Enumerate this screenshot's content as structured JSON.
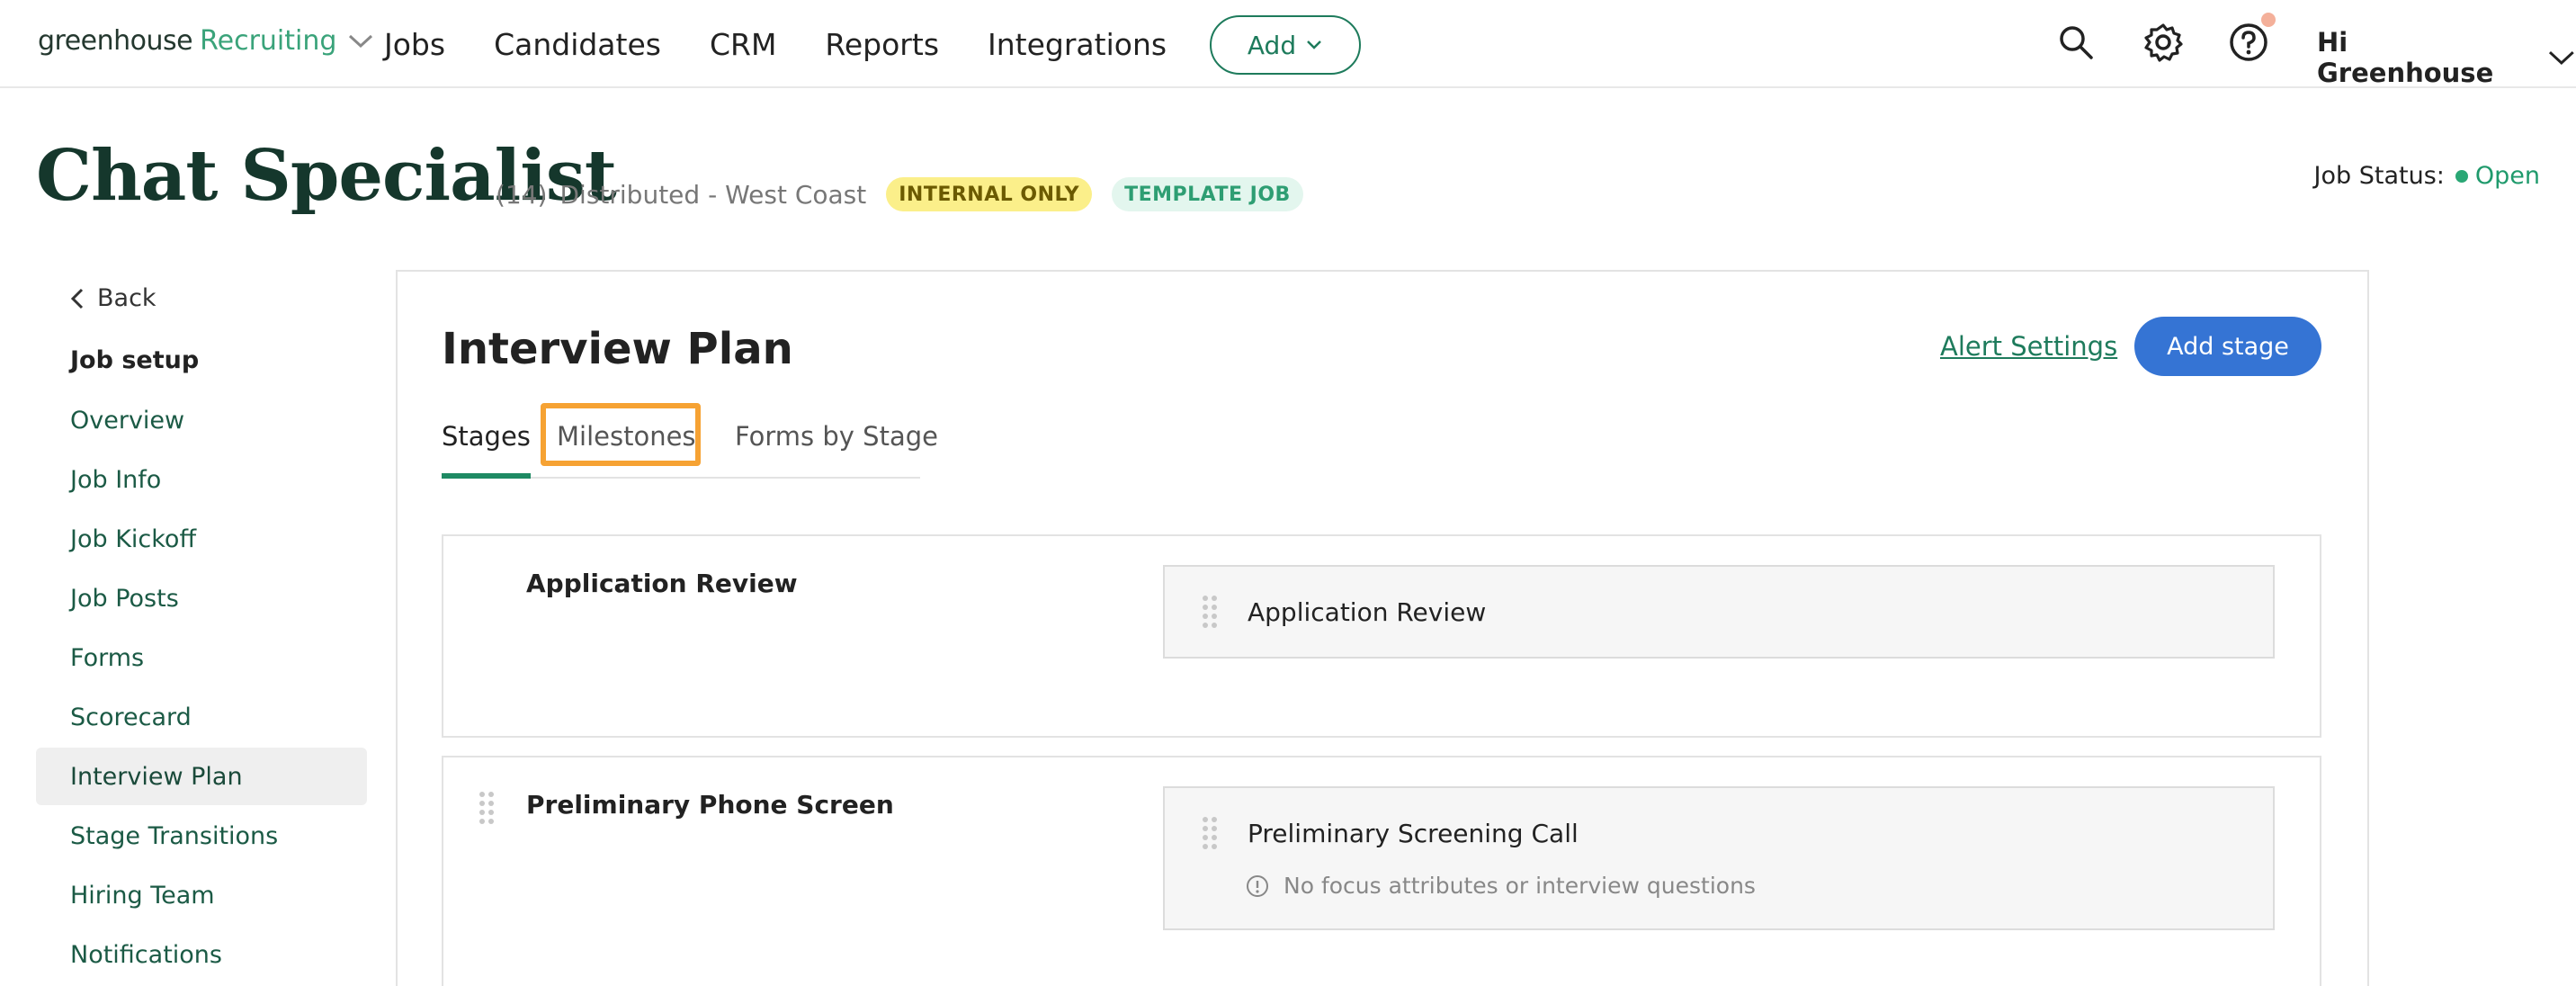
{
  "brand": {
    "name": "greenhouse",
    "product": "Recruiting"
  },
  "nav": {
    "links": [
      "Jobs",
      "Candidates",
      "CRM",
      "Reports",
      "Integrations"
    ],
    "add_label": "Add",
    "greeting": "Hi Greenhouse"
  },
  "job": {
    "title": "Chat Specialist",
    "count": "(14)",
    "location": "Distributed - West Coast",
    "badges": [
      "INTERNAL ONLY",
      "TEMPLATE JOB"
    ],
    "status_label": "Job Status:",
    "status_value": "Open"
  },
  "sidebar": {
    "back_label": "Back",
    "heading": "Job setup",
    "items": [
      "Overview",
      "Job Info",
      "Job Kickoff",
      "Job Posts",
      "Forms",
      "Scorecard",
      "Interview Plan",
      "Stage Transitions",
      "Hiring Team",
      "Notifications"
    ],
    "active_item": "Interview Plan"
  },
  "main": {
    "title": "Interview Plan",
    "alert_settings_label": "Alert Settings",
    "add_stage_label": "Add stage",
    "tabs": [
      "Stages",
      "Milestones",
      "Forms by Stage"
    ],
    "active_tab": "Stages",
    "highlighted_tab": "Milestones",
    "stages": [
      {
        "name": "Application Review",
        "interviews": [
          {
            "name": "Application Review"
          }
        ]
      },
      {
        "name": "Preliminary Phone Screen",
        "interviews": [
          {
            "name": "Preliminary Screening Call",
            "note": "No focus attributes or interview questions"
          }
        ]
      }
    ]
  },
  "colors": {
    "brand_green": "#1e7b5c",
    "primary_blue": "#3574d4",
    "highlight_orange": "#f6a233",
    "internal_badge_bg": "#fbef8a",
    "template_badge_bg": "#e3f6ee",
    "status_open": "#2aa775"
  }
}
